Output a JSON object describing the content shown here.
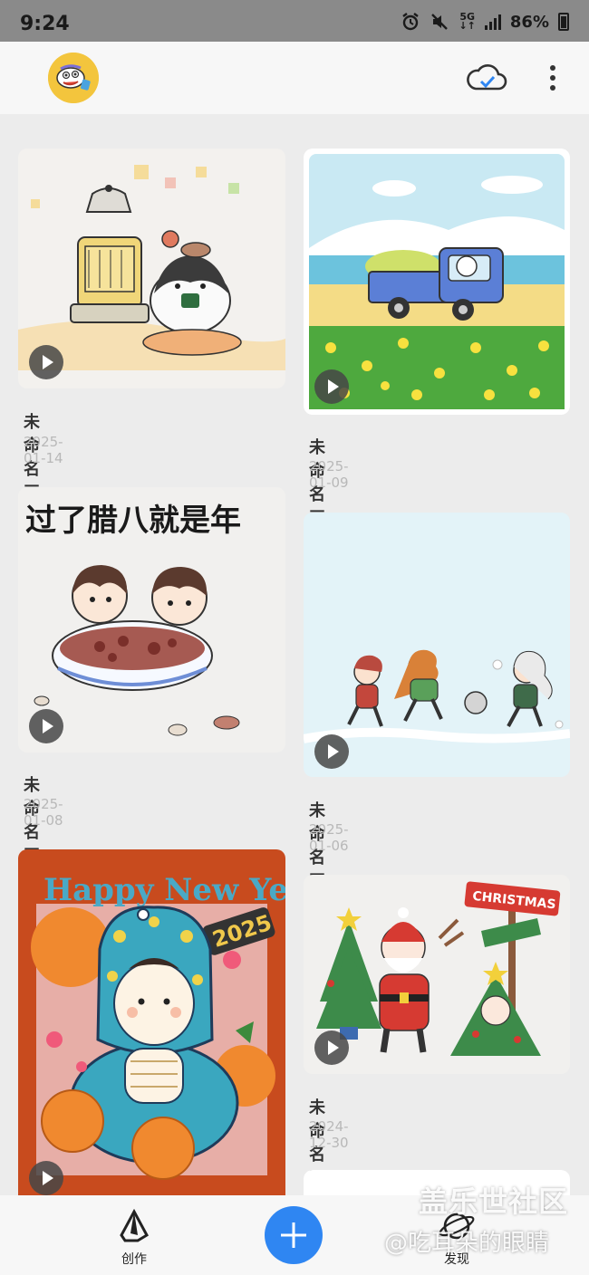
{
  "status_bar": {
    "time": "9:24",
    "network": "5G",
    "battery": "86%"
  },
  "header": {
    "avatar_icon": "cartoon-avatar",
    "cloud_icon": "cloud-sync-check-icon",
    "more_icon": "more-vertical-icon"
  },
  "canvases": [
    {
      "title": "未命名画布",
      "date": "2025-01-14",
      "scene": "kettle-heater-penguin"
    },
    {
      "title": "未命名画布",
      "date": "2025-01-09",
      "scene": "blue-truck-flower-field"
    },
    {
      "title": "未命名画布",
      "date": "2025-01-08",
      "scene": "laba-congee-bowl"
    },
    {
      "title": "未命名画布",
      "date": "2025-01-06",
      "scene": "kids-running-snow"
    },
    {
      "title": "",
      "date": "",
      "scene": "happy-new-year-2025-snake"
    },
    {
      "title": "未命名画布",
      "date": "2024-12-30",
      "scene": "christmas-santa-trees"
    }
  ],
  "artwork_text": {
    "laba": "过了腊八就是年",
    "happy_new_year": "Happy New Year",
    "year_2025": "2025",
    "christmas": "CHRISTMAS"
  },
  "bottom_nav": {
    "create_label": "创作",
    "discover_label": "发现",
    "add_icon": "plus-icon"
  },
  "watermark": {
    "line1": "盖乐世社区",
    "line2": "@吃耳朵的眼睛"
  },
  "colors": {
    "accent": "#2f86f2",
    "avatar_bg": "#f3c53d",
    "background": "#ececec"
  }
}
